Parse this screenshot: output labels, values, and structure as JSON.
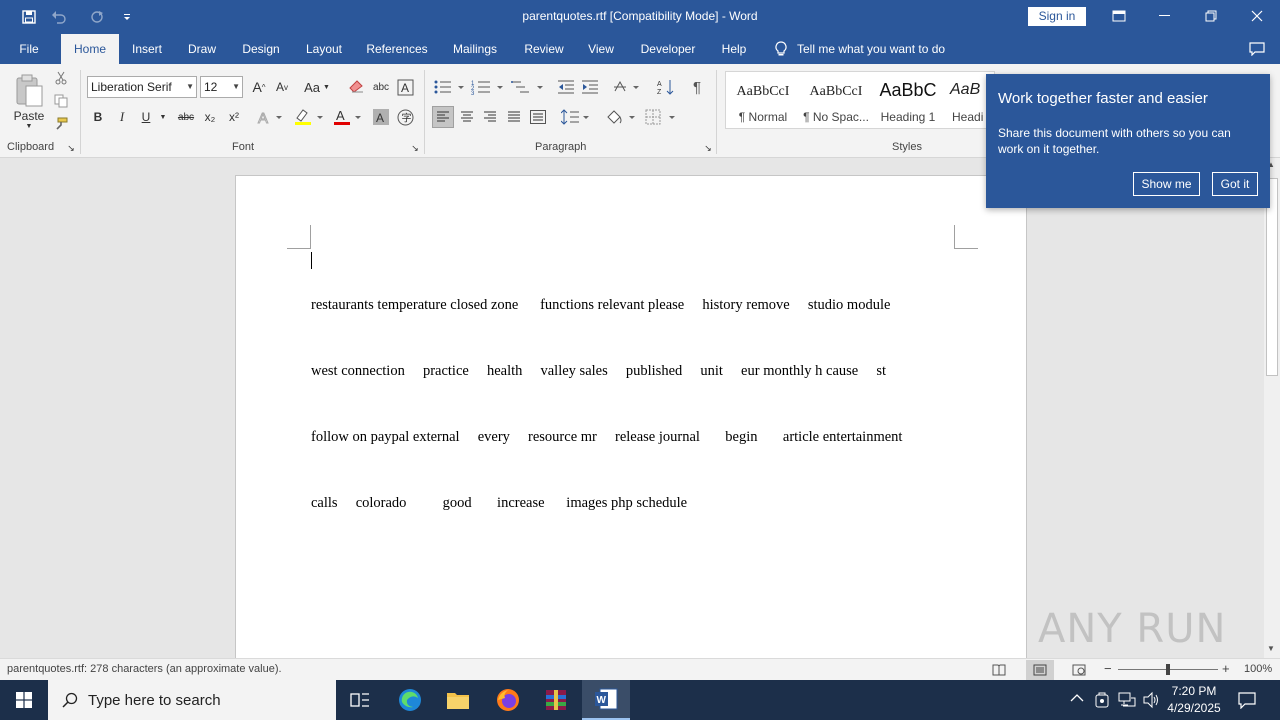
{
  "titlebar": {
    "title": "parentquotes.rtf [Compatibility Mode]  -  Word",
    "sign_in": "Sign in",
    "colors": {
      "accent": "#2b579a"
    }
  },
  "tabs": [
    {
      "label": "File"
    },
    {
      "label": "Home"
    },
    {
      "label": "Insert"
    },
    {
      "label": "Draw"
    },
    {
      "label": "Design"
    },
    {
      "label": "Layout"
    },
    {
      "label": "References"
    },
    {
      "label": "Mailings"
    },
    {
      "label": "Review"
    },
    {
      "label": "View"
    },
    {
      "label": "Developer"
    },
    {
      "label": "Help"
    }
  ],
  "tell_me": "Tell me what you want to do",
  "ribbon": {
    "clipboard": {
      "paste": "Paste",
      "label": "Clipboard"
    },
    "font": {
      "family": "Liberation Serif",
      "size": "12",
      "label": "Font",
      "bold": "B",
      "italic": "I",
      "underline": "U",
      "strike": "abc",
      "sub": "x₂",
      "sup": "x²",
      "grow": "A",
      "shrink": "A",
      "case": "Aa"
    },
    "paragraph": {
      "label": "Paragraph",
      "pilcrow": "¶"
    },
    "styles": {
      "label": "Styles",
      "items": [
        {
          "preview": "AaBbCcI",
          "name": "¶ Normal"
        },
        {
          "preview": "AaBbCcI",
          "name": "¶ No Spac..."
        },
        {
          "preview": "AaBbC",
          "name": "Heading 1"
        },
        {
          "preview": "AaB",
          "name": "Headi"
        }
      ]
    }
  },
  "document": {
    "lines": [
      "restaurants temperature closed zone      functions relevant please     history remove     studio module",
      "west connection     practice     health     valley sales     published     unit     eur monthly h cause     st",
      "follow on paypal external     every     resource mr     release journal       begin       article entertainment",
      "calls     colorado          good       increase      images php schedule"
    ]
  },
  "popup": {
    "title": "Work together faster and easier",
    "body": "Share this document with others so you can work on it together.",
    "show_me": "Show me",
    "got_it": "Got it"
  },
  "statusbar": {
    "text": "parentquotes.rtf: 278 characters (an approximate value).",
    "zoom": "100%"
  },
  "taskbar": {
    "search_placeholder": "Type here to search",
    "time": "7:20 PM",
    "date": "4/29/2025"
  },
  "watermark": "ANY RUN"
}
